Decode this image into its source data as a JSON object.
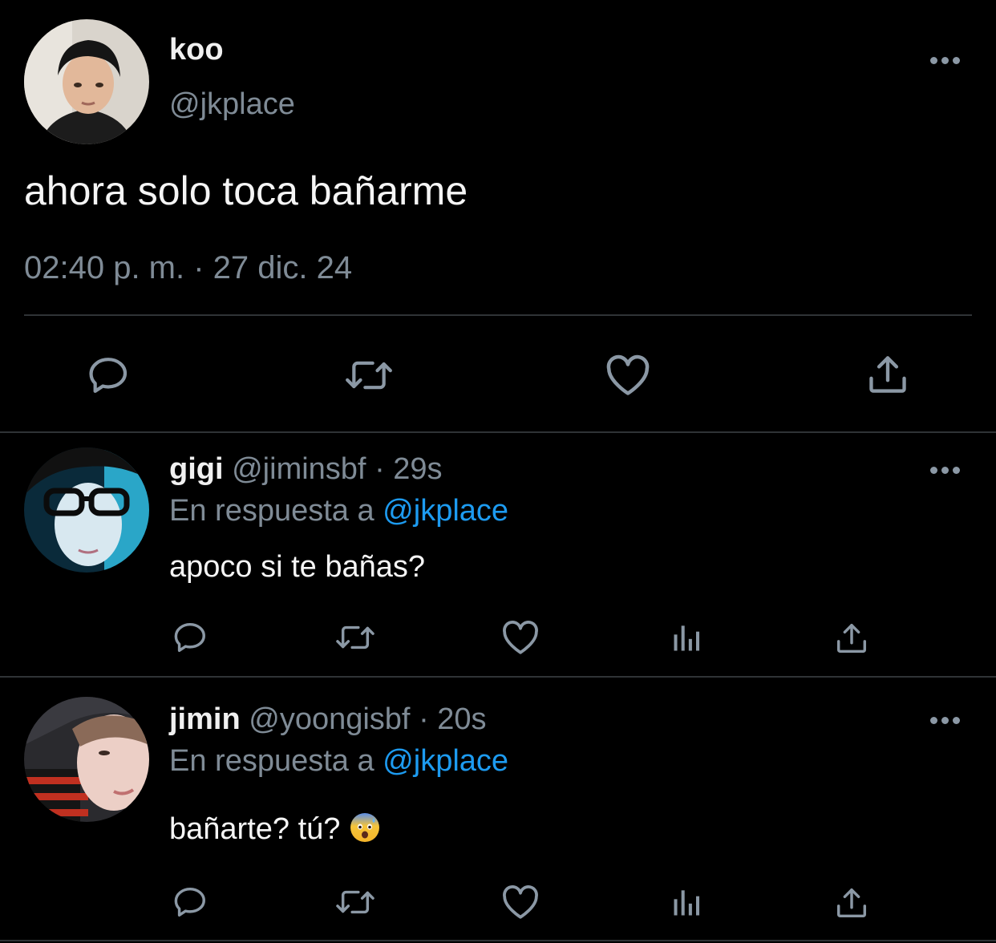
{
  "main_tweet": {
    "display_name": "koo",
    "handle": "@jkplace",
    "text": "ahora solo toca bañarme",
    "timestamp": "02:40 p. m. · 27 dic. 24",
    "more_icon": "more-horizontal-icon",
    "actions": [
      {
        "icon": "reply-icon"
      },
      {
        "icon": "retweet-icon"
      },
      {
        "icon": "heart-icon"
      },
      {
        "icon": "share-icon"
      }
    ]
  },
  "replies": [
    {
      "display_name": "gigi",
      "handle": "@jiminsbf",
      "separator": "·",
      "time": "29s",
      "reply_prefix": "En respuesta a",
      "reply_to": "@jkplace",
      "text": "apoco si te bañas?"
    },
    {
      "display_name": "jimin",
      "handle": "@yoongisbf",
      "separator": "·",
      "time": "20s",
      "reply_prefix": "En respuesta a",
      "reply_to": "@jkplace",
      "text": "bañarte? tú?",
      "emoji": "anxious-face-with-sweat-icon"
    }
  ],
  "colors": {
    "background": "#000000",
    "text": "#e7e9ea",
    "muted": "#7f8b96",
    "link": "#1d9bf0",
    "divider": "#2f3336"
  }
}
